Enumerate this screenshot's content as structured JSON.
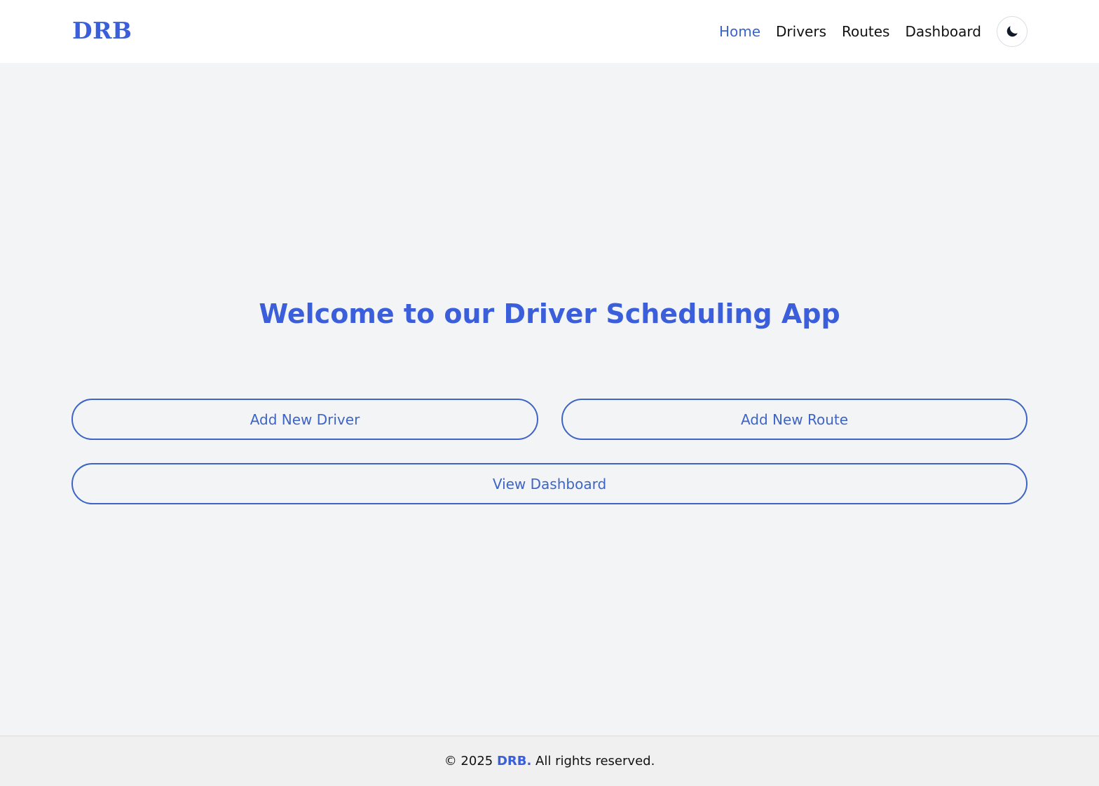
{
  "header": {
    "logo": "DRB",
    "nav": {
      "home": "Home",
      "drivers": "Drivers",
      "routes": "Routes",
      "dashboard": "Dashboard"
    },
    "theme_toggle_icon": "moon-icon"
  },
  "main": {
    "title": "Welcome to our Driver Scheduling App",
    "buttons": {
      "add_driver": "Add New Driver",
      "add_route": "Add New Route",
      "view_dashboard": "View Dashboard"
    }
  },
  "footer": {
    "prefix": "© 2025 ",
    "brand": "DRB.",
    "suffix": " All rights reserved."
  },
  "colors": {
    "accent": "#3b5fdb",
    "button_border": "#3d64c6",
    "page_background": "#f3f4f6",
    "header_background": "#ffffff",
    "footer_background": "#f0f0f0"
  }
}
